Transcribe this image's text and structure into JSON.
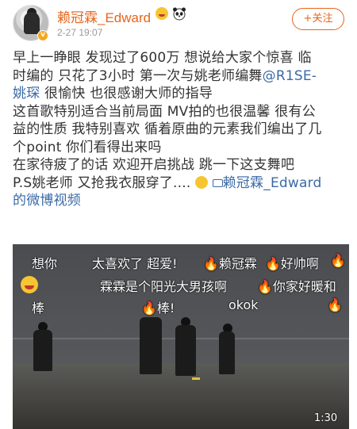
{
  "header": {
    "username": "赖冠霖_Edward",
    "time": "2-27 19:07",
    "follow_label": "+关注"
  },
  "post": {
    "lines": [
      "早上一睁眼 发现过了600万 想说给大家个惊喜 临",
      "时编的 只花了3小时 第一次与姚老师编舞",
      "姚琛 很愉快 也很感谢大师的指导",
      "这首歌特别适合当前局面 MV拍的也很温馨 很有公",
      "益的性质 我特别喜欢 循着原曲的元素我们编出了几",
      "个point 你们看得出来吗",
      "在家待疲了的话 欢迎开启挑战 跳一下这支舞吧",
      "P.S姚老师 又抢我衣服穿了...."
    ],
    "mention": "@R1SE-",
    "video_link": "赖冠霖_Edward",
    "video_link_suffix": "的微博视频"
  },
  "video": {
    "danmaku": [
      "想你",
      "太喜欢了 超爱!",
      "🔥赖冠霖",
      "🔥好帅啊",
      "🔥",
      "霖霖是个阳光大男孩啊",
      "🔥你家好暖和",
      "棒",
      "🔥棒!",
      "okok",
      "🔥"
    ],
    "duration": "1:30"
  }
}
